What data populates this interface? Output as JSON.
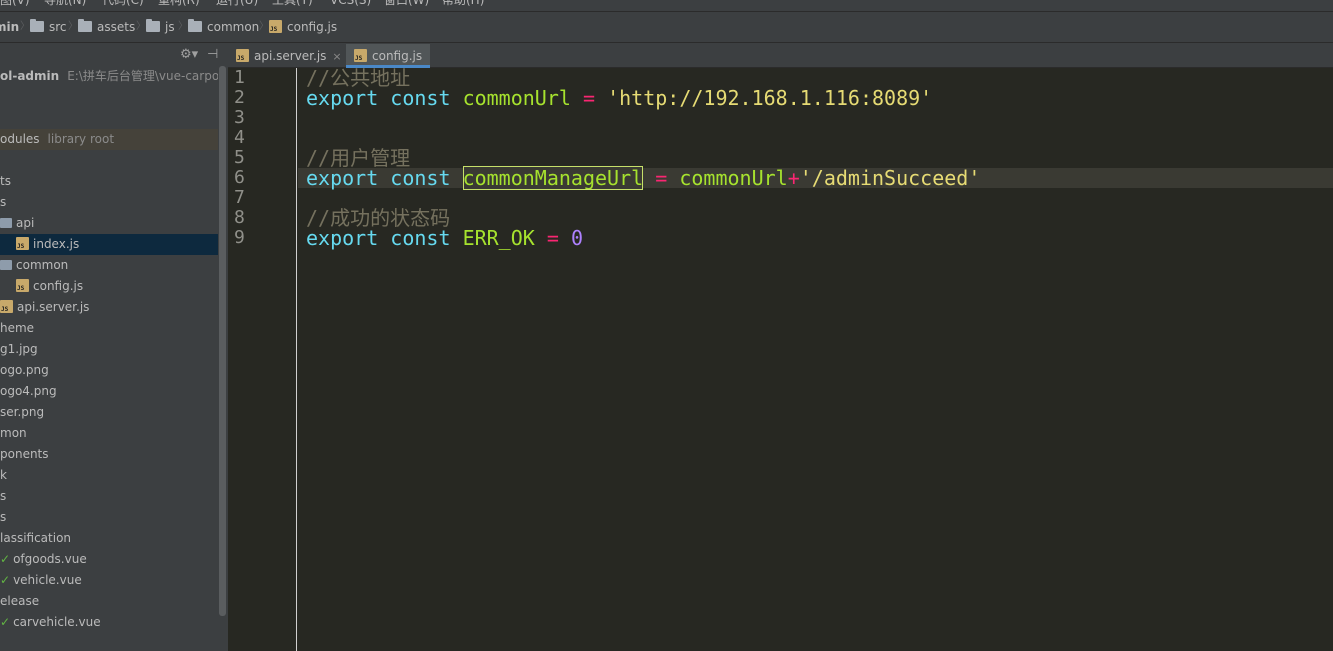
{
  "menubar": [
    {
      "label": "图(V)"
    },
    {
      "label": "导航(N)"
    },
    {
      "label": "代码(C)"
    },
    {
      "label": "重构(R)"
    },
    {
      "label": "运行(U)"
    },
    {
      "label": "工具(T)"
    },
    {
      "label": "VCS(S)"
    },
    {
      "label": "窗口(W)"
    },
    {
      "label": "帮助(H)"
    }
  ],
  "breadcrumb": [
    {
      "label": "min",
      "icon": "none"
    },
    {
      "label": "src",
      "icon": "folder-icon"
    },
    {
      "label": "assets",
      "icon": "folder-icon"
    },
    {
      "label": "js",
      "icon": "folder-icon"
    },
    {
      "label": "common",
      "icon": "folder-icon"
    },
    {
      "label": "config.js",
      "icon": "js-file-icon"
    }
  ],
  "project": {
    "rows": [
      {
        "label": "ol-admin",
        "extra": "E:\\拼车后台管理\\vue-carpool-a",
        "kind": "root"
      },
      {
        "label": "",
        "kind": "blank"
      },
      {
        "label": "",
        "kind": "blank"
      },
      {
        "label": "odules",
        "extra": "library root",
        "kind": "lib"
      },
      {
        "label": "",
        "kind": "blank"
      },
      {
        "label": "ts",
        "kind": "plain"
      },
      {
        "label": "s",
        "kind": "plain"
      },
      {
        "label": "api",
        "kind": "folder"
      },
      {
        "label": "index.js",
        "kind": "js",
        "selected": true
      },
      {
        "label": "common",
        "kind": "folder"
      },
      {
        "label": "config.js",
        "kind": "js"
      },
      {
        "label": "api.server.js",
        "kind": "js"
      },
      {
        "label": "heme",
        "kind": "plain"
      },
      {
        "label": "g1.jpg",
        "kind": "plain"
      },
      {
        "label": "ogo.png",
        "kind": "plain"
      },
      {
        "label": "ogo4.png",
        "kind": "plain"
      },
      {
        "label": "ser.png",
        "kind": "plain"
      },
      {
        "label": "mon",
        "kind": "plain"
      },
      {
        "label": "ponents",
        "kind": "plain"
      },
      {
        "label": "k",
        "kind": "plain"
      },
      {
        "label": "s",
        "kind": "plain"
      },
      {
        "label": "s",
        "kind": "plain"
      },
      {
        "label": "lassification",
        "kind": "plain"
      },
      {
        "label": "ofgoods.vue",
        "kind": "vue"
      },
      {
        "label": "vehicle.vue",
        "kind": "vue"
      },
      {
        "label": "elease",
        "kind": "plain"
      },
      {
        "label": "carvehicle.vue",
        "kind": "vue"
      }
    ]
  },
  "tabs": [
    {
      "label": "api.server.js",
      "active": false
    },
    {
      "label": "config.js",
      "active": true
    }
  ],
  "editor": {
    "line_numbers": [
      "1",
      "2",
      "3",
      "4",
      "5",
      "6",
      "7",
      "8",
      "9"
    ],
    "lines": [
      [
        {
          "t": "//公共地址",
          "c": "cm"
        }
      ],
      [
        {
          "t": "export",
          "c": "kw"
        },
        {
          "t": " ",
          "c": "plain"
        },
        {
          "t": "const",
          "c": "kw"
        },
        {
          "t": " ",
          "c": "plain"
        },
        {
          "t": "commonUrl",
          "c": "var"
        },
        {
          "t": " ",
          "c": "plain"
        },
        {
          "t": "=",
          "c": "op"
        },
        {
          "t": " ",
          "c": "plain"
        },
        {
          "t": "'http://192.168.1.116:8089'",
          "c": "str"
        }
      ],
      [],
      [],
      [
        {
          "t": "//用户管理",
          "c": "cm"
        }
      ],
      [
        {
          "t": "export",
          "c": "kw"
        },
        {
          "t": " ",
          "c": "plain"
        },
        {
          "t": "const",
          "c": "kw"
        },
        {
          "t": " ",
          "c": "plain"
        },
        {
          "t": "commonManageUrl",
          "c": "var hl-box"
        },
        {
          "t": " ",
          "c": "plain"
        },
        {
          "t": "=",
          "c": "op"
        },
        {
          "t": " ",
          "c": "plain"
        },
        {
          "t": "commonUrl",
          "c": "var"
        },
        {
          "t": "+",
          "c": "op"
        },
        {
          "t": "'/adminSucceed'",
          "c": "str"
        }
      ],
      [],
      [
        {
          "t": "//成功的状态码",
          "c": "cm"
        }
      ],
      [
        {
          "t": "export",
          "c": "kw"
        },
        {
          "t": " ",
          "c": "plain"
        },
        {
          "t": "const",
          "c": "kw"
        },
        {
          "t": " ",
          "c": "plain"
        },
        {
          "t": "ERR_OK",
          "c": "var"
        },
        {
          "t": " ",
          "c": "plain"
        },
        {
          "t": "=",
          "c": "op"
        },
        {
          "t": " ",
          "c": "plain"
        },
        {
          "t": "0",
          "c": "num"
        }
      ]
    ],
    "current_line": "6"
  },
  "colors": {
    "editor_bg": "#272822",
    "keyword": "#66d9ef",
    "identifier": "#a6e22e",
    "operator": "#f92672",
    "string": "#e6db74",
    "number": "#ae81ff",
    "comment": "#75715e",
    "selection": "#0d293e",
    "accent": "#4a88c7"
  }
}
